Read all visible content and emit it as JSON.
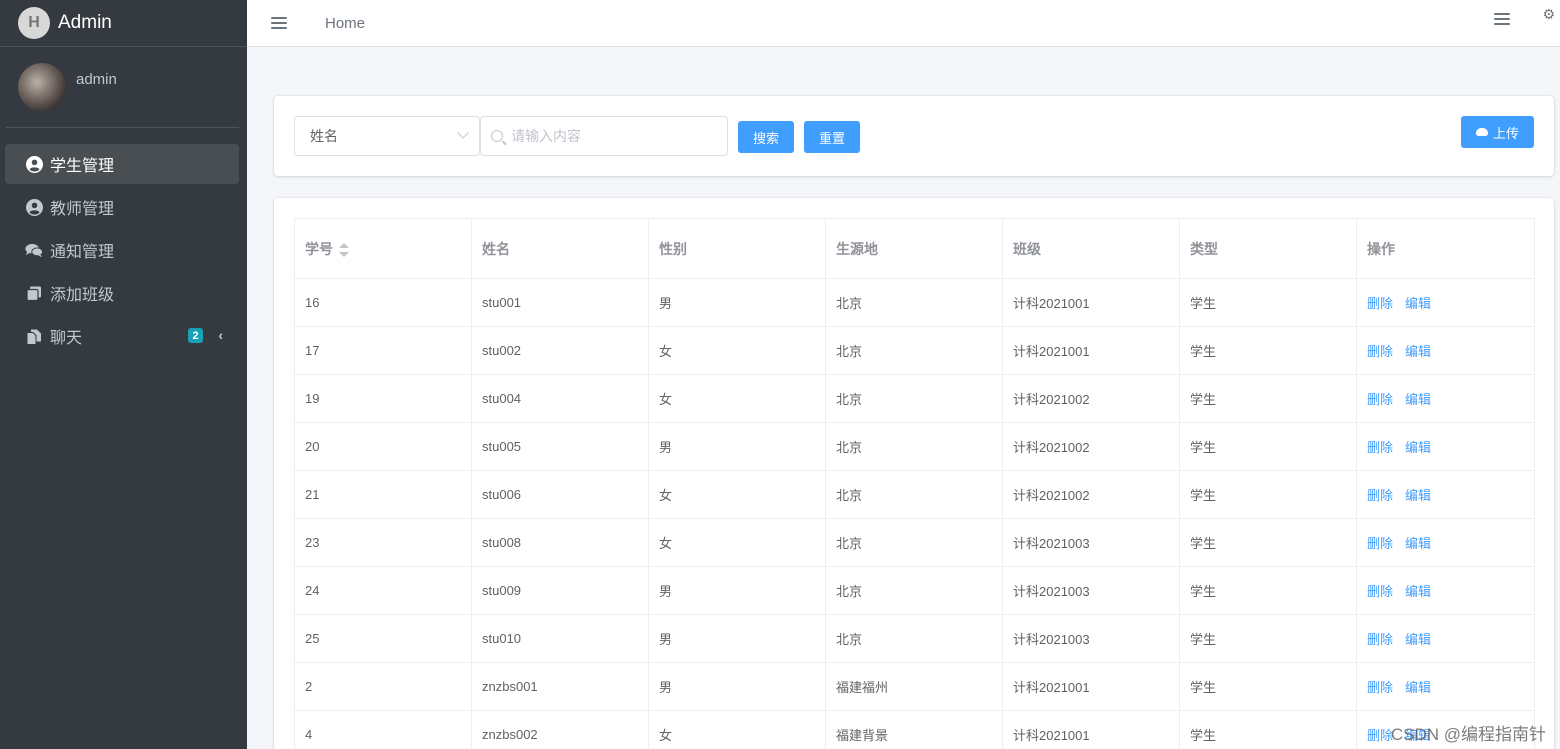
{
  "brand": {
    "title": "Admin",
    "logo_icon": "admin-logo-icon"
  },
  "user": {
    "name": "admin"
  },
  "sidebar": {
    "items": [
      {
        "label": "学生管理",
        "icon": "user-circle-icon",
        "active": true
      },
      {
        "label": "教师管理",
        "icon": "user-circle-icon",
        "active": false
      },
      {
        "label": "通知管理",
        "icon": "comments-icon",
        "active": false
      },
      {
        "label": "添加班级",
        "icon": "copy-icon",
        "active": false
      },
      {
        "label": "聊天",
        "icon": "file-icon",
        "active": false,
        "badge": "2"
      }
    ]
  },
  "topbar": {
    "home_label": "Home"
  },
  "search": {
    "select_value": "姓名",
    "placeholder": "请输入内容",
    "search_label": "搜索",
    "reset_label": "重置",
    "upload_label": "上传"
  },
  "table": {
    "headers": [
      "学号",
      "姓名",
      "性别",
      "生源地",
      "班级",
      "类型",
      "操作"
    ],
    "delete_label": "删除",
    "edit_label": "编辑",
    "rows": [
      [
        "16",
        "stu001",
        "男",
        "北京",
        "计科2021001",
        "学生"
      ],
      [
        "17",
        "stu002",
        "女",
        "北京",
        "计科2021001",
        "学生"
      ],
      [
        "19",
        "stu004",
        "女",
        "北京",
        "计科2021002",
        "学生"
      ],
      [
        "20",
        "stu005",
        "男",
        "北京",
        "计科2021002",
        "学生"
      ],
      [
        "21",
        "stu006",
        "女",
        "北京",
        "计科2021002",
        "学生"
      ],
      [
        "23",
        "stu008",
        "女",
        "北京",
        "计科2021003",
        "学生"
      ],
      [
        "24",
        "stu009",
        "男",
        "北京",
        "计科2021003",
        "学生"
      ],
      [
        "25",
        "stu010",
        "男",
        "北京",
        "计科2021003",
        "学生"
      ],
      [
        "2",
        "znzbs001",
        "男",
        "福建福州",
        "计科2021001",
        "学生"
      ],
      [
        "4",
        "znzbs002",
        "女",
        "福建背景",
        "计科2021001",
        "学生"
      ]
    ]
  },
  "watermark": "CSDN @编程指南针",
  "colors": {
    "sidebar_bg": "#343a40",
    "primary": "#409eff",
    "badge": "#17a2b8"
  }
}
